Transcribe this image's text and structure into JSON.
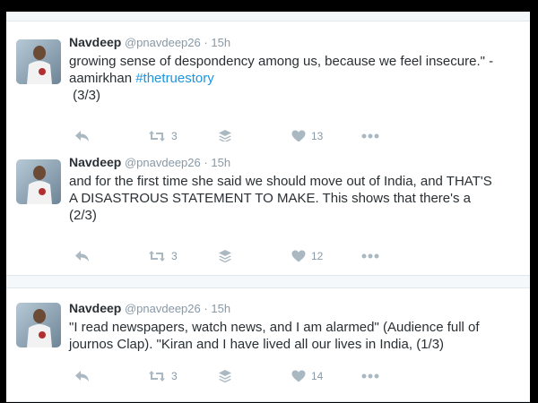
{
  "tweets": [
    {
      "name": "Navdeep",
      "handle": "@pnavdeep26",
      "separator": "·",
      "time": "15h",
      "text_lines": [
        "growing sense of despondency among us, because we feel insecure.\" -",
        "aamirkhan "
      ],
      "hashtag": "#thetruestory",
      "tail_line": " (3/3)",
      "retweets": "3",
      "likes": "13"
    },
    {
      "name": "Navdeep",
      "handle": "@pnavdeep26",
      "separator": "·",
      "time": "15h",
      "text_lines": [
        "and for the first time she said we should move out of India, and THAT'S",
        "A DISASTROUS STATEMENT TO MAKE. This shows that there's a",
        "(2/3)"
      ],
      "retweets": "3",
      "likes": "12"
    },
    {
      "name": "Navdeep",
      "handle": "@pnavdeep26",
      "separator": "·",
      "time": "15h",
      "text_lines": [
        "\"I read newspapers, watch news, and I am alarmed\" (Audience full of",
        "journos Clap). \"Kiran and I have lived all our lives in India, (1/3)"
      ],
      "retweets": "3",
      "likes": "14"
    }
  ],
  "icons": {
    "reply": "reply-icon",
    "retweet": "retweet-icon",
    "buffer": "buffer-layers-icon",
    "like": "heart-icon",
    "more": "more-dots-icon"
  },
  "colors": {
    "hashtag": "#1b95e0",
    "icon": "#aab8c2",
    "meta": "#8899a6"
  }
}
